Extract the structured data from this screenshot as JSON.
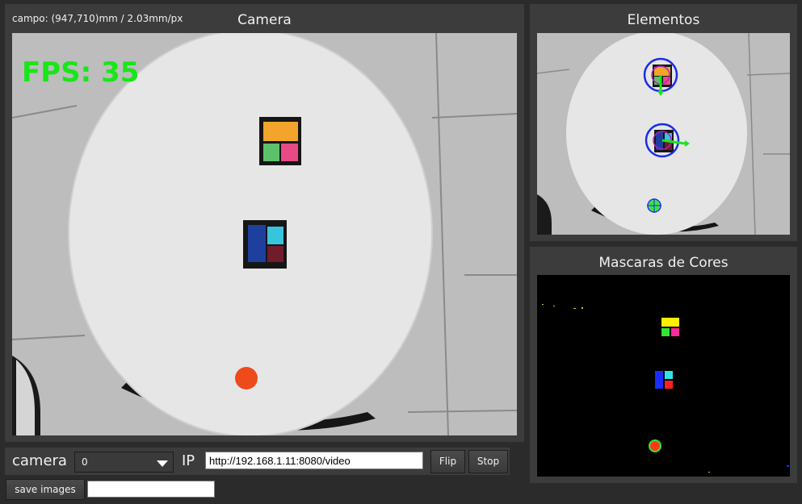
{
  "camera_panel": {
    "info": "campo: (947,710)mm / 2.03mm/px",
    "title": "Camera",
    "fps_label": "FPS: 35"
  },
  "elements_panel": {
    "title": "Elementos"
  },
  "masks_panel": {
    "title": "Mascaras de Cores"
  },
  "controls": {
    "camera_label": "camera",
    "camera_select_value": "0",
    "ip_label": "IP",
    "ip_value": "http://192.168.1.11:8080/video",
    "flip_label": "Flip",
    "stop_label": "Stop",
    "save_images_label": "save images",
    "save_images_value": ""
  },
  "colors": {
    "background": "#2b2b2b",
    "panel": "#3c3c3c",
    "fps_green": "#19e619",
    "detection_blue": "#1a2ce6",
    "detection_green": "#19e619"
  }
}
